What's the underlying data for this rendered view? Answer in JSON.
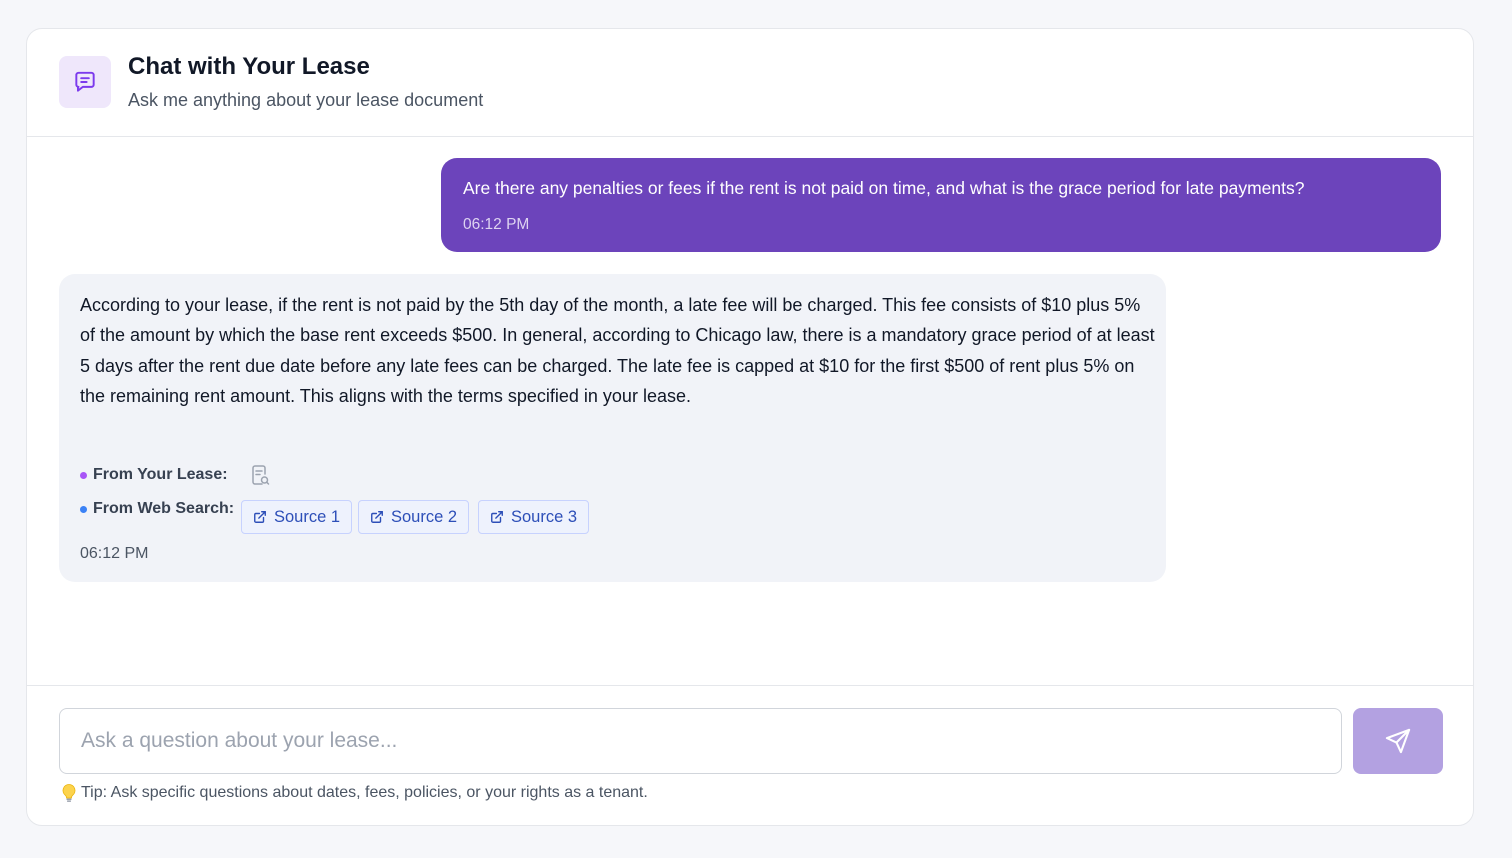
{
  "header": {
    "title": "Chat with Your Lease",
    "subtitle": "Ask me anything about your lease document",
    "icon": "chat-message-icon"
  },
  "messages": [
    {
      "role": "user",
      "text": "Are there any penalties or fees if the rent is not paid on time, and what is the grace period for late payments?",
      "time": "06:12 PM"
    },
    {
      "role": "assistant",
      "text": "According to your lease, if the rent is not paid by the 5th day of the month, a late fee will be charged. This fee consists of $10 plus 5% of the amount by which the base rent exceeds $500. In general, according to Chicago law, there is a mandatory grace period of at least 5 days after the rent due date before any late fees can be charged. The late fee is capped at $10 for the first $500 of rent plus 5% on the remaining rent amount. This aligns with the terms specified in your lease.",
      "lease_label": "From Your Lease:",
      "lease_icon": "document-search-icon",
      "web_label": "From Web Search:",
      "sources": [
        "Source 1",
        "Source 2",
        "Source 3"
      ],
      "time": "06:12 PM"
    }
  ],
  "composer": {
    "placeholder": "Ask a question about your lease...",
    "value": "",
    "send_icon": "send-icon",
    "tip": "Tip: Ask specific questions about dates, fees, policies, or your rights as a tenant.",
    "tip_icon": "lightbulb-icon"
  },
  "colors": {
    "accent": "#6c44bb",
    "send_button": "#b3a1e1",
    "lease_dot": "#a855f7",
    "web_dot": "#3b82f6",
    "link": "#2d4fb8"
  }
}
